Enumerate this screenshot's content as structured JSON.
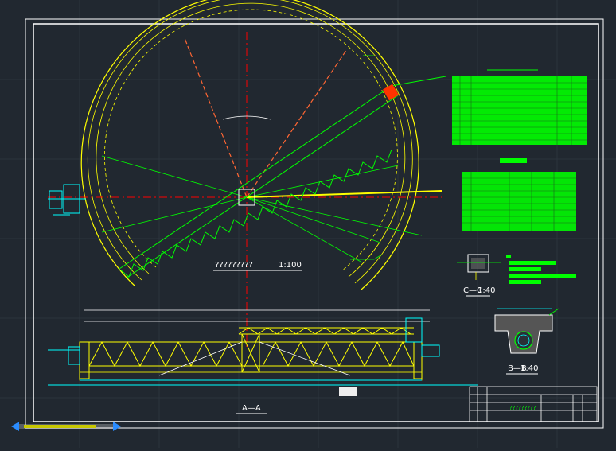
{
  "drawing": {
    "plan_title": "?????????",
    "plan_scale": "1:100",
    "section_a": "A—A",
    "section_b": "B—B",
    "section_b_scale": "1:40",
    "section_c": "C—C",
    "section_c_scale": "1:40",
    "title_block_text": "?????????",
    "scrollbar_label": "",
    "colors": {
      "background": "#212830",
      "outline": "#ffffff",
      "structure": "#ffff00",
      "detail": "#00ff00",
      "dims": "#00ffff",
      "centerline": "#ff0000",
      "accent": "#ff3300"
    }
  }
}
